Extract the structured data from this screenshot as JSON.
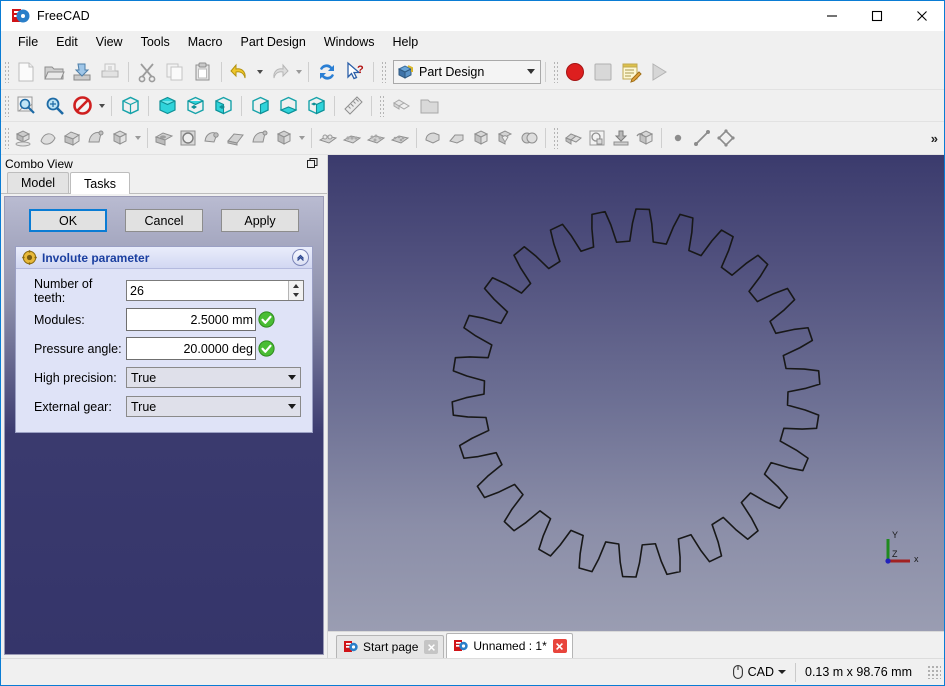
{
  "window": {
    "title": "FreeCAD",
    "app_icon": "freecad-logo-icon",
    "minimize": "minimize-icon",
    "maximize": "maximize-icon",
    "close": "close-icon"
  },
  "menubar": {
    "items": [
      {
        "label": "File"
      },
      {
        "label": "Edit"
      },
      {
        "label": "View"
      },
      {
        "label": "Tools"
      },
      {
        "label": "Macro"
      },
      {
        "label": "Part Design"
      },
      {
        "label": "Windows"
      },
      {
        "label": "Help"
      }
    ]
  },
  "toolbars": {
    "file": [
      {
        "icon": "new-document-icon",
        "enabled": false
      },
      {
        "icon": "open-folder-icon",
        "enabled": true
      },
      {
        "icon": "save-icon",
        "enabled": true
      },
      {
        "icon": "print-icon",
        "enabled": false
      },
      {
        "icon": "cut-scissors-icon",
        "enabled": false
      },
      {
        "icon": "copy-icon",
        "enabled": false
      },
      {
        "icon": "paste-icon",
        "enabled": true
      },
      {
        "icon": "undo-arrow-icon",
        "enabled": true
      },
      {
        "icon": "redo-arrow-icon",
        "enabled": false
      },
      {
        "icon": "refresh-icon",
        "enabled": true
      },
      {
        "icon": "whats-this-cursor-icon",
        "enabled": true
      }
    ],
    "workbench": {
      "label": "Part Design",
      "icon": "workbench-box-icon",
      "caret": "chevron-down-icon"
    },
    "macro": [
      {
        "icon": "macro-record-icon",
        "enabled": true
      },
      {
        "icon": "macro-stop-icon",
        "enabled": false
      },
      {
        "icon": "macro-edit-icon",
        "enabled": true
      },
      {
        "icon": "macro-execute-play-icon",
        "enabled": false
      }
    ],
    "view": [
      {
        "icon": "fit-all-icon",
        "enabled": true
      },
      {
        "icon": "fit-selection-zoom-icon",
        "enabled": true
      },
      {
        "icon": "draw-style-icon",
        "enabled": true
      },
      {
        "icon": "axonometric-view-icon",
        "enabled": true
      },
      {
        "icon": "front-view-icon",
        "enabled": true
      },
      {
        "icon": "top-view-icon",
        "enabled": true
      },
      {
        "icon": "right-view-icon",
        "enabled": true
      },
      {
        "icon": "rear-view-icon",
        "enabled": true
      },
      {
        "icon": "bottom-view-icon",
        "enabled": true
      },
      {
        "icon": "left-view-icon",
        "enabled": true
      },
      {
        "icon": "measure-ruler-icon",
        "enabled": true
      },
      {
        "icon": "workbench-stack-icon",
        "enabled": false
      },
      {
        "icon": "folder-group-icon",
        "enabled": false
      }
    ],
    "partdesign": [
      {
        "icon": "create-body-icon",
        "enabled": false
      },
      {
        "icon": "create-sketch-icon",
        "enabled": false
      },
      {
        "icon": "pad-icon",
        "enabled": false
      },
      {
        "icon": "revolution-icon",
        "enabled": false
      },
      {
        "icon": "additive-box-icon",
        "enabled": false
      },
      {
        "icon": "pocket-icon",
        "enabled": false
      },
      {
        "icon": "hole-icon",
        "enabled": false
      },
      {
        "icon": "groove-icon",
        "enabled": false
      },
      {
        "icon": "subtractive-loft-icon",
        "enabled": false
      },
      {
        "icon": "subtractive-pipe-icon",
        "enabled": false
      },
      {
        "icon": "subtractive-box-icon",
        "enabled": false
      },
      {
        "icon": "mirrored-icon",
        "enabled": false
      },
      {
        "icon": "linear-pattern-icon",
        "enabled": false
      },
      {
        "icon": "polar-pattern-icon",
        "enabled": false
      },
      {
        "icon": "multi-transform-icon",
        "enabled": false
      },
      {
        "icon": "fillet-icon",
        "enabled": false
      },
      {
        "icon": "chamfer-icon",
        "enabled": false
      },
      {
        "icon": "draft-icon",
        "enabled": false
      },
      {
        "icon": "thickness-icon",
        "enabled": false
      },
      {
        "icon": "boolean-icon",
        "enabled": false
      },
      {
        "icon": "sketch-attach-icon",
        "enabled": true
      },
      {
        "icon": "map-sketch-icon",
        "enabled": true
      },
      {
        "icon": "validate-sketch-icon",
        "enabled": true
      },
      {
        "icon": "shape-binder-icon",
        "enabled": true
      },
      {
        "icon": "create-point-icon",
        "enabled": true
      },
      {
        "icon": "create-line-icon",
        "enabled": true
      },
      {
        "icon": "create-plane-icon",
        "enabled": true
      }
    ],
    "overflow": "»"
  },
  "combo_view": {
    "title": "Combo View",
    "float_button": "float-panel-icon",
    "tabs": [
      {
        "label": "Model",
        "active": false
      },
      {
        "label": "Tasks",
        "active": true
      }
    ]
  },
  "task_panel": {
    "buttons": [
      {
        "label": "OK",
        "focused": true
      },
      {
        "label": "Cancel",
        "focused": false
      },
      {
        "label": "Apply",
        "focused": false
      }
    ],
    "group": {
      "title": "Involute parameter",
      "icon": "gear-icon",
      "collapse_icon": "chevron-up-icon",
      "fields": [
        {
          "label": "Number of teeth:",
          "type": "spinbox",
          "value": "26",
          "name": "number-of-teeth-input"
        },
        {
          "label": "Modules:",
          "type": "quantity",
          "value": "2.5000 mm",
          "valid": true,
          "name": "modules-input"
        },
        {
          "label": "Pressure angle:",
          "type": "quantity",
          "value": "20.0000 deg",
          "valid": true,
          "name": "pressure-angle-input"
        },
        {
          "label": "High precision:",
          "type": "combobox",
          "value": "True",
          "name": "high-precision-select"
        },
        {
          "label": "External gear:",
          "type": "combobox",
          "value": "True",
          "name": "external-gear-select"
        }
      ]
    }
  },
  "viewport": {
    "background_top": "#3b3b6d",
    "background_bottom": "#9a9db2",
    "gear_stroke": "#181818",
    "gear": {
      "teeth": 26,
      "module_mm": 2.5,
      "pressure_angle_deg": 20
    },
    "axis": {
      "x_label": "x",
      "y_label": "Y",
      "z_label": "Z",
      "x_color": "#a22222",
      "y_color": "#1f8a1f",
      "z_color": "#2222bb"
    }
  },
  "doc_tabs": [
    {
      "label": "Start page",
      "active": false,
      "icon": "freecad-logo-icon",
      "close": "close-icon"
    },
    {
      "label": "Unnamed : 1*",
      "active": true,
      "icon": "freecad-logo-icon",
      "close": "close-icon"
    }
  ],
  "statusbar": {
    "nav_icon": "mouse-icon",
    "nav_style": "CAD",
    "nav_caret": "chevron-down-icon",
    "dimensions": "0.13 m x 98.76 mm",
    "resize_grip": "resize-grip-icon"
  }
}
